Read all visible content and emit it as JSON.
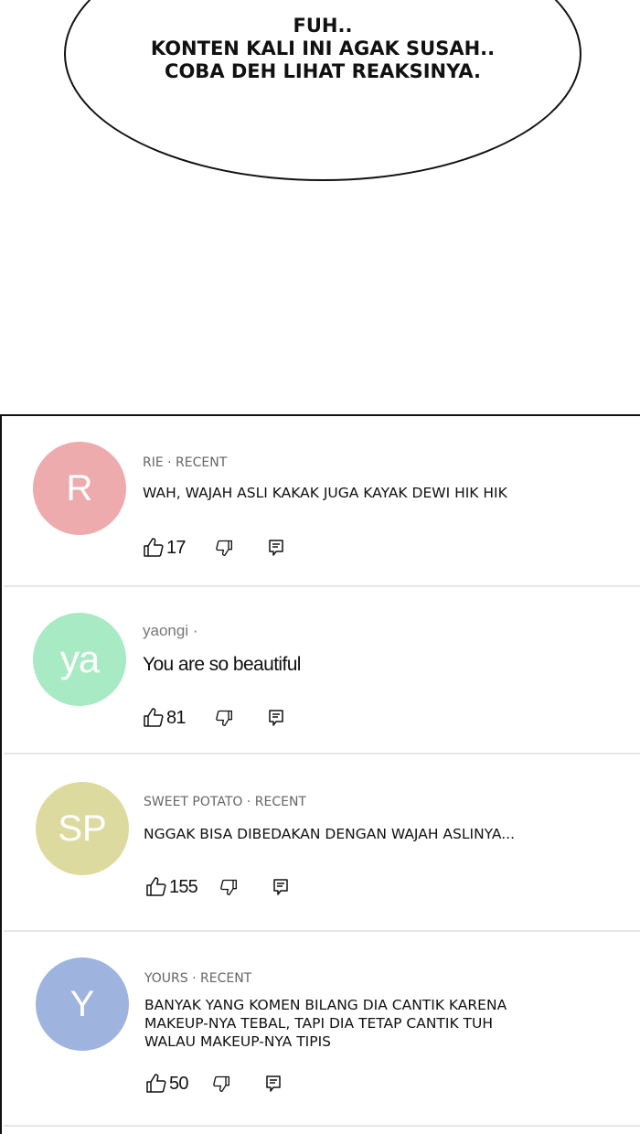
{
  "bubble": {
    "lines": [
      "FUH..",
      "KONTEN KALI INI AGAK SUSAH..",
      "COBA DEH LIHAT REAKSINYA."
    ]
  },
  "comments": [
    {
      "initials": "R",
      "avatar_color": "#eeabad",
      "author": "RIE",
      "time": "RECENT",
      "meta": "RIE · RECENT",
      "text": "WAH, WAJAH ASLI KAKAK JUGA KAYAK DEWI HIK HIK",
      "likes": "17"
    },
    {
      "initials": "ya",
      "avatar_color": "#a8eac4",
      "author": "yaongi",
      "meta": "yaongi ·",
      "text": "You are so beautiful",
      "likes": "81"
    },
    {
      "initials": "SP",
      "avatar_color": "#ddda9f",
      "author": "SWEET POTATO",
      "time": "RECENT",
      "meta": "SWEET POTATO · RECENT",
      "text": "NGGAK BISA DIBEDAKAN DENGAN WAJAH ASLINYA...",
      "likes": "155"
    },
    {
      "initials": "Y",
      "avatar_color": "#9eb4df",
      "author": "YOURS",
      "time": "RECENT",
      "meta": "YOURS · RECENT",
      "text_lines": [
        "BANYAK YANG KOMEN BILANG DIA CANTIK KARENA",
        "MAKEUP-NYA TEBAL, TAPI DIA TETAP CANTIK TUH",
        "WALAU MAKEUP-NYA TIPIS"
      ],
      "likes": "50"
    }
  ],
  "icons": {
    "like": "thumbs-up-icon",
    "dislike": "thumbs-down-icon",
    "reply": "reply-icon"
  }
}
